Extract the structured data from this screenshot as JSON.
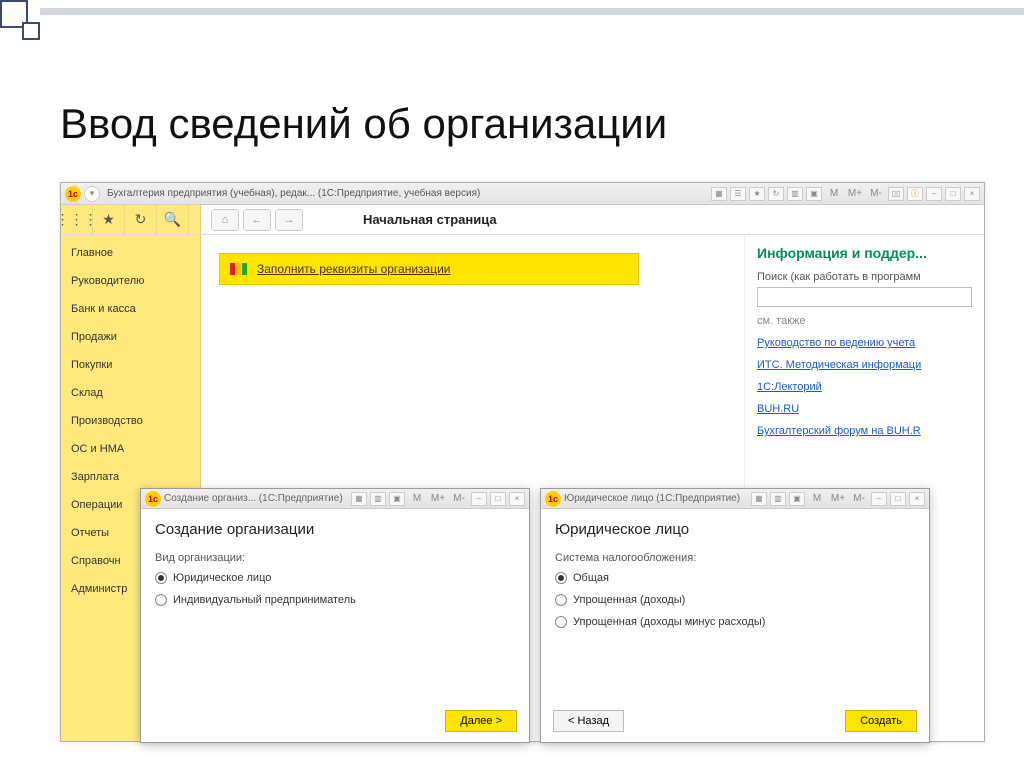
{
  "slide_title": "Ввод сведений об организации",
  "main_window": {
    "title": "Бухгалтерия предприятия (учебная), редак...  (1С:Предприятие, учебная версия)",
    "toolbar_glyphs": [
      "M",
      "M+",
      "M-"
    ],
    "page_caption": "Начальная страница"
  },
  "sidebar": {
    "items": [
      "Главное",
      "Руководителю",
      "Банк и касса",
      "Продажи",
      "Покупки",
      "Склад",
      "Производство",
      "ОС и НМА",
      "Зарплата",
      "Операции",
      "Отчеты",
      "Справочн",
      "Администр"
    ]
  },
  "banner": {
    "link_text": "Заполнить реквизиты организации"
  },
  "right_panel": {
    "title": "Информация и поддер...",
    "search_label": "Поиск (как работать в программ",
    "search_value": "",
    "see_also": "см. также",
    "links": [
      "Руководство по ведению учета",
      "ИТС. Методическая информаци",
      "1С:Лекторий",
      "BUH.RU",
      "Бухгалтерский форум на BUH.R"
    ]
  },
  "dialog1": {
    "titlebar": "Создание организ... (1С:Предприятие)",
    "heading": "Создание организации",
    "field_label": "Вид организации:",
    "options": [
      "Юридическое лицо",
      "Индивидуальный предприниматель"
    ],
    "next": "Далее >"
  },
  "dialog2": {
    "titlebar": "Юридическое лицо (1С:Предприятие)",
    "heading": "Юридическое лицо",
    "field_label": "Система налогообложения:",
    "options": [
      "Общая",
      "Упрощенная (доходы)",
      "Упрощенная (доходы минус расходы)"
    ],
    "back": "< Назад",
    "create": "Создать"
  }
}
